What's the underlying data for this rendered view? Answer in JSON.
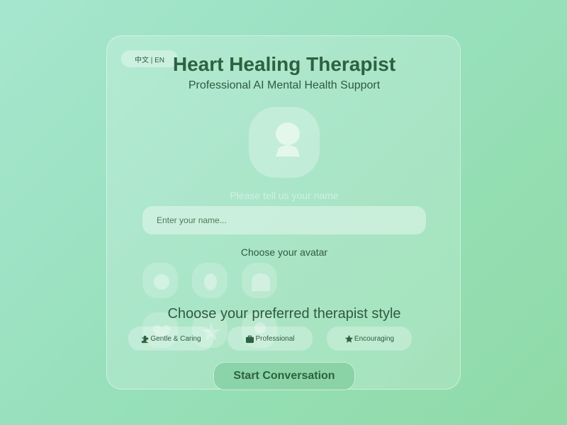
{
  "language_toggle": {
    "label": "中文 | EN"
  },
  "header": {
    "title": "Heart Healing Therapist",
    "subtitle": "Professional AI Mental Health Support"
  },
  "profile": {
    "name_prompt": "Please tell us your name",
    "name_placeholder": "Enter your name...",
    "name_value": ""
  },
  "avatar_picker": {
    "label": "Choose your avatar",
    "options": [
      {
        "icon": "circle-avatar-icon"
      },
      {
        "icon": "oval-avatar-icon"
      },
      {
        "icon": "dome-avatar-icon"
      },
      {
        "icon": "heart-avatar-icon"
      },
      {
        "icon": "star-avatar-icon"
      },
      {
        "icon": "person-avatar-icon"
      }
    ]
  },
  "therapist_style": {
    "label": "Choose your preferred therapist style",
    "options": [
      {
        "label": "Gentle & Caring",
        "icon": "puzzle-icon"
      },
      {
        "label": "Professional",
        "icon": "briefcase-icon"
      },
      {
        "label": "Encouraging",
        "icon": "star-icon"
      }
    ]
  },
  "actions": {
    "start_label": "Start Conversation"
  },
  "colors": {
    "accent_text": "#2d6140",
    "background_start": "#a6e6cf",
    "background_end": "#8fdaa6"
  }
}
